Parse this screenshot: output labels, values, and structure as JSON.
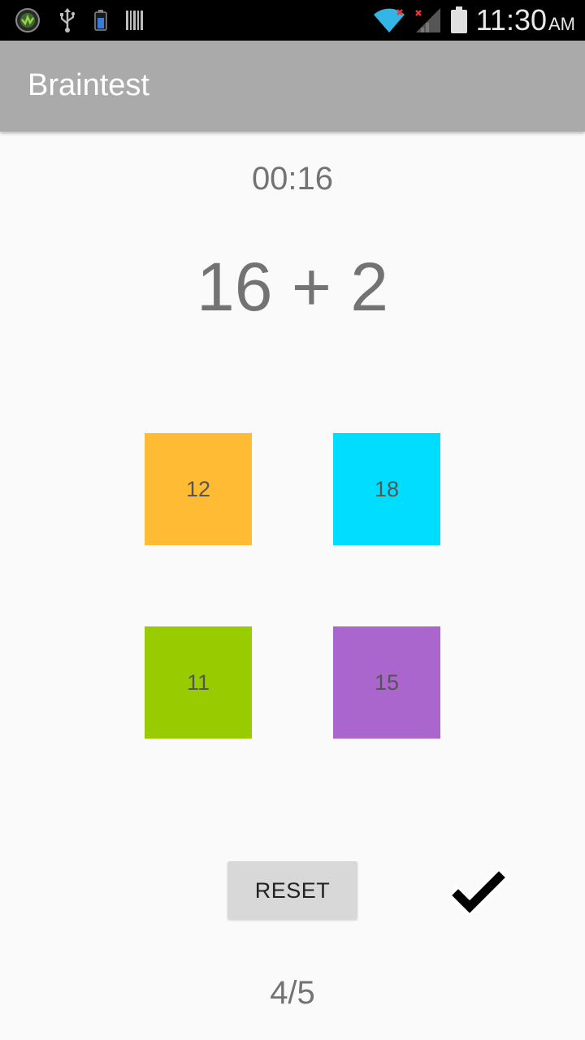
{
  "status_bar": {
    "time": "11:30",
    "ampm": "AM",
    "icons": [
      "app-notification-icon",
      "usb-icon",
      "battery-small-icon",
      "barcode-icon",
      "wifi-icon",
      "signal-icon",
      "battery-icon"
    ]
  },
  "app_bar": {
    "title": "Braintest"
  },
  "game": {
    "timer": "00:16",
    "question": "16 + 2",
    "answers": [
      {
        "label": "12",
        "color": "#ffbb33"
      },
      {
        "label": "18",
        "color": "#00ddff"
      },
      {
        "label": "11",
        "color": "#99cc00"
      },
      {
        "label": "15",
        "color": "#aa66cc"
      }
    ],
    "reset_label": "RESET",
    "result_icon": "checkmark-icon",
    "score": "4/5"
  }
}
